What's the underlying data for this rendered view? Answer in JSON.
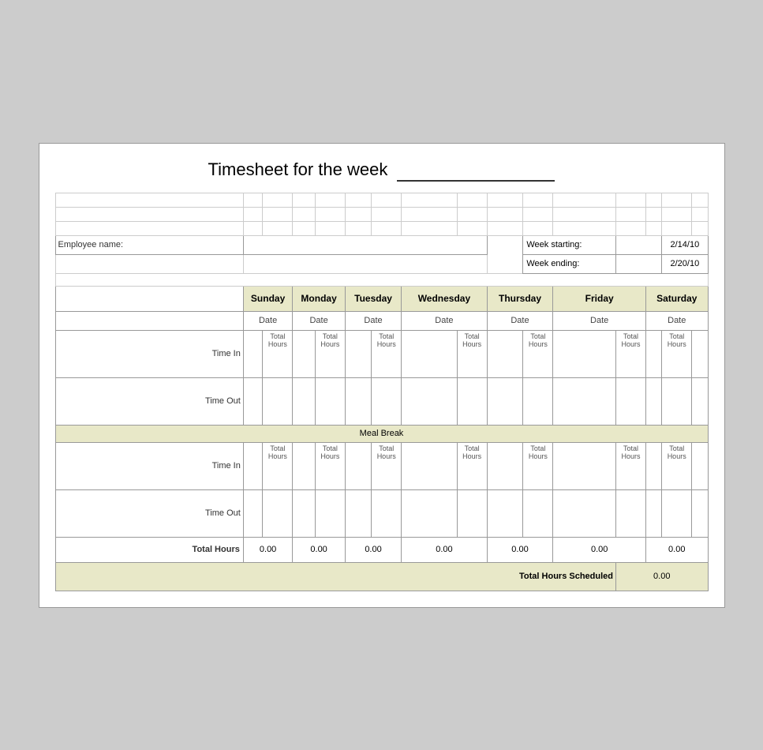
{
  "title": {
    "text": "Timesheet for the week",
    "underline_placeholder": ""
  },
  "employee": {
    "label": "Employee name:",
    "value": ""
  },
  "week": {
    "starting_label": "Week starting:",
    "starting_value": "2/14/10",
    "ending_label": "Week ending:",
    "ending_value": "2/20/10"
  },
  "days": [
    "Sunday",
    "Monday",
    "Tuesday",
    "Wednesday",
    "Thursday",
    "Friday",
    "Saturday"
  ],
  "dates": [
    "Date",
    "Date",
    "Date",
    "Date",
    "Date",
    "Date",
    "Date"
  ],
  "sections": {
    "time_in_label": "Time In",
    "time_out_label": "Time Out",
    "meal_break": "Meal Break",
    "total_hours_label": "Total Hours",
    "hours_label": "Total\nHours",
    "hours_short": "Hours"
  },
  "totals": {
    "sunday": "0.00",
    "monday": "0.00",
    "tuesday": "0.00",
    "wednesday": "0.00",
    "thursday": "0.00",
    "friday": "0.00",
    "saturday": "0.00",
    "grand_label": "Total Hours Scheduled",
    "grand_value": "0.00"
  },
  "colors": {
    "header_bg": "#e8e8c8",
    "border": "#999"
  }
}
